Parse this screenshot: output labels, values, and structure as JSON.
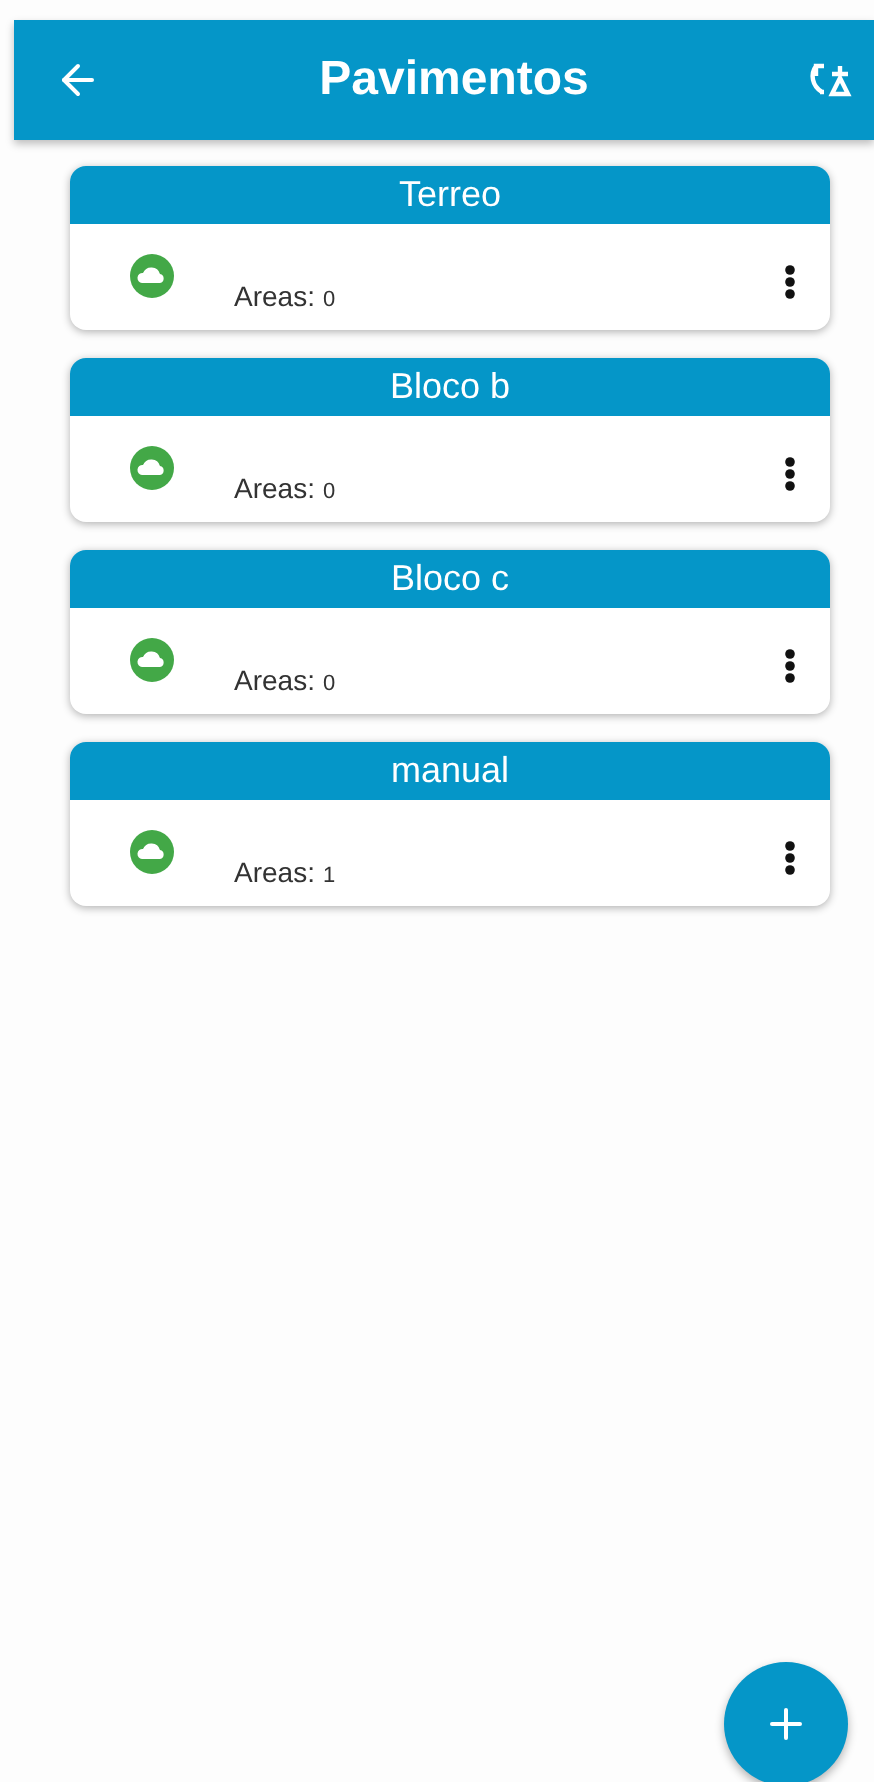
{
  "app_bar": {
    "title": "Pavimentos"
  },
  "floors": [
    {
      "name": "Terreo",
      "areas_label": "Areas:",
      "areas_count": "0"
    },
    {
      "name": "Bloco b",
      "areas_label": "Areas:",
      "areas_count": "0"
    },
    {
      "name": "Bloco c",
      "areas_label": "Areas:",
      "areas_count": "0"
    },
    {
      "name": "manual",
      "areas_label": "Areas:",
      "areas_count": "1"
    }
  ]
}
